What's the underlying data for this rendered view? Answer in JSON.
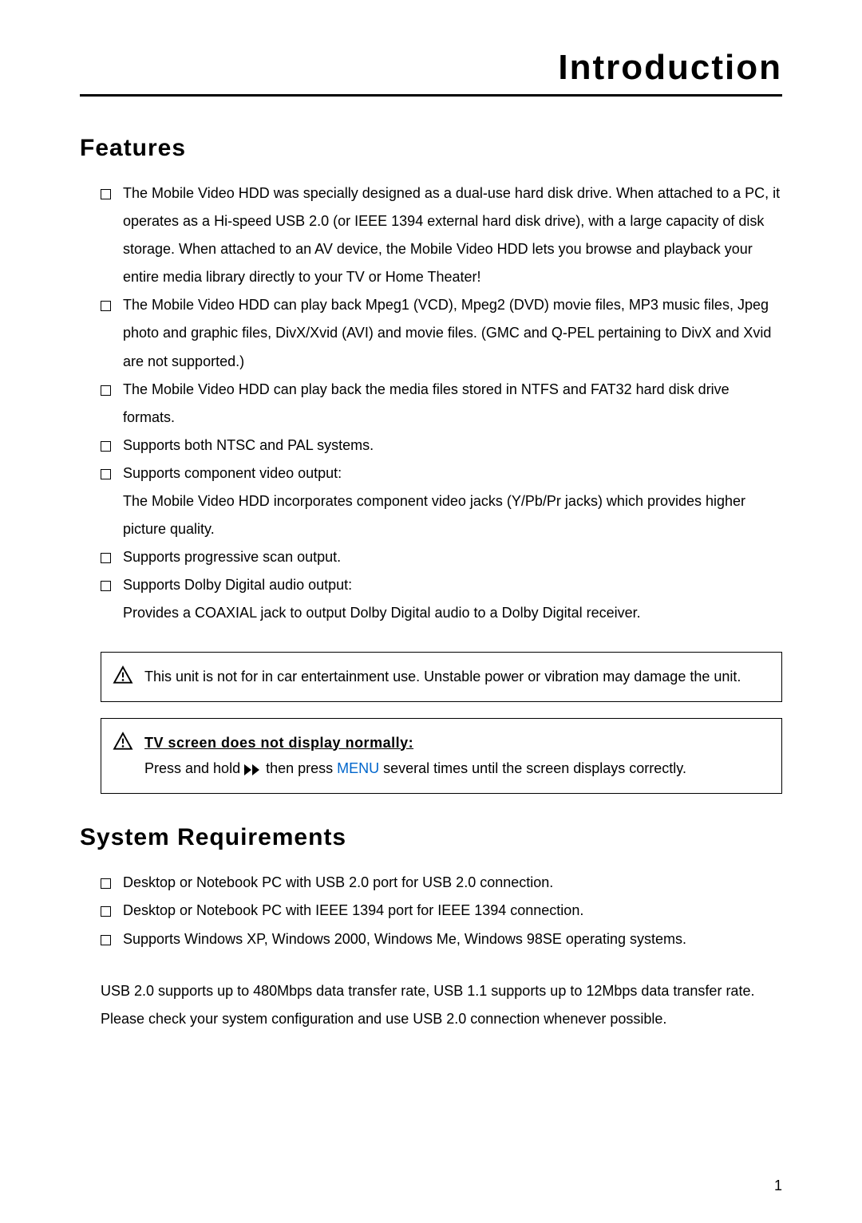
{
  "pageTitle": "Introduction",
  "features": {
    "heading": "Features",
    "items": [
      "The Mobile Video HDD was specially designed as a dual-use hard disk drive. When attached to a PC, it operates as a Hi-speed USB 2.0 (or IEEE 1394 external hard disk drive), with a large capacity of disk storage. When attached to an AV device, the Mobile Video HDD lets you browse and playback your entire media library directly to your TV or Home Theater!",
      "The Mobile Video HDD can play back Mpeg1 (VCD), Mpeg2 (DVD) movie files, MP3 music files, Jpeg photo and graphic files, DivX/Xvid (AVI) and movie files. (GMC and Q-PEL pertaining to DivX and Xvid are not supported.)",
      "The Mobile Video HDD can play back the media files stored in NTFS and FAT32 hard disk drive formats.",
      "Supports both NTSC and PAL systems.",
      "Supports component video output:",
      "Supports progressive scan output.",
      "Supports Dolby Digital audio output:"
    ],
    "item4_sub": "The Mobile Video HDD incorporates component video jacks (Y/Pb/Pr jacks) which provides higher picture quality.",
    "item6_sub": "Provides a COAXIAL jack to output Dolby Digital audio to a Dolby Digital receiver."
  },
  "warning1": {
    "text": "This unit is not for in car entertainment use. Unstable power or vibration may damage the unit."
  },
  "warning2": {
    "heading": "TV screen does not display normally:",
    "text_before": "Press and hold  ",
    "text_mid1": " then press ",
    "menu_label": "MENU",
    "text_after": " several times until the screen displays correctly."
  },
  "sysreq": {
    "heading": "System Requirements",
    "items": [
      "Desktop or Notebook PC with USB 2.0 port for USB 2.0 connection.",
      "Desktop or Notebook PC with IEEE 1394 port for IEEE 1394 connection.",
      "Supports Windows XP, Windows 2000, Windows Me, Windows 98SE operating systems."
    ],
    "paragraph": "USB 2.0 supports up to 480Mbps data transfer rate, USB 1.1 supports up to 12Mbps data transfer rate. Please check your system configuration and use USB 2.0 connection whenever possible."
  },
  "pageNumber": "1"
}
